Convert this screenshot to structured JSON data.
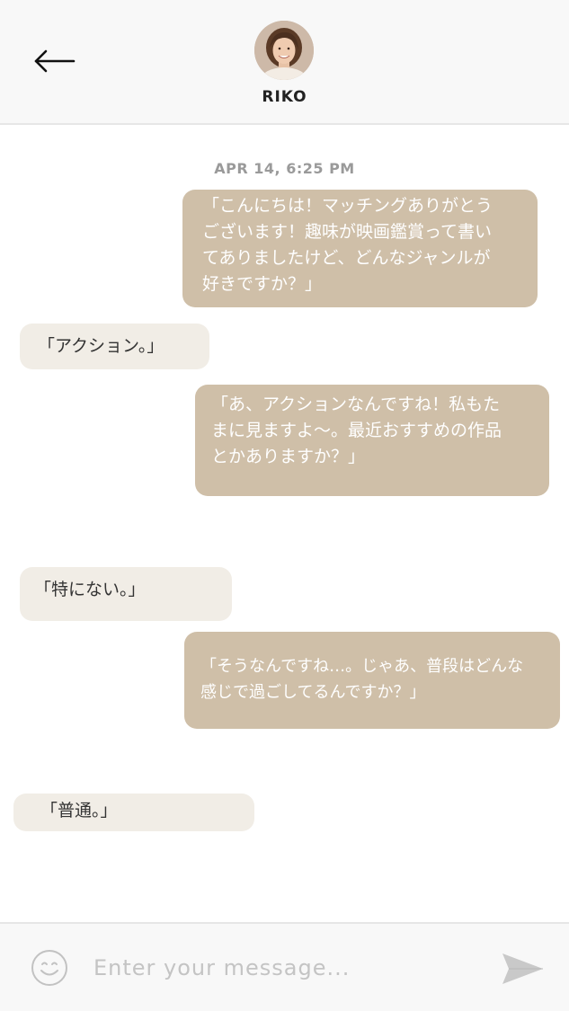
{
  "header": {
    "contact_name": "RIKO",
    "back_icon": "arrow-left-icon",
    "avatar_icon": "user-avatar"
  },
  "chat": {
    "timestamp": "APR 14, 6:25 PM",
    "messages": [
      {
        "direction": "outgoing",
        "text": "「こんにちは！マッチングありがとう\nございます！趣味が映画鑑賞って書い\nてありましたけど、どんなジャンルが\n好きですか？」"
      },
      {
        "direction": "incoming",
        "text": "「アクション。」"
      },
      {
        "direction": "outgoing",
        "text": "「あ、アクションなんですね！私もた\nまに見ますよ〜。最近おすすめの作品\nとかありますか？」"
      },
      {
        "direction": "incoming",
        "text": "「特にない。」"
      },
      {
        "direction": "outgoing",
        "text": "「そうなんですね…。じゃあ、普段はどんな\n感じで過ごしてるんですか？」"
      },
      {
        "direction": "incoming",
        "text": "「普通。」"
      }
    ]
  },
  "composer": {
    "placeholder": "Enter your message...",
    "value": "",
    "emoji_icon": "smiley-face-icon",
    "send_icon": "send-arrow-icon"
  },
  "colors": {
    "outgoing_bubble": "#cfbfa8",
    "incoming_bubble": "#f1ede6",
    "header_bg": "#f8f8f8"
  }
}
